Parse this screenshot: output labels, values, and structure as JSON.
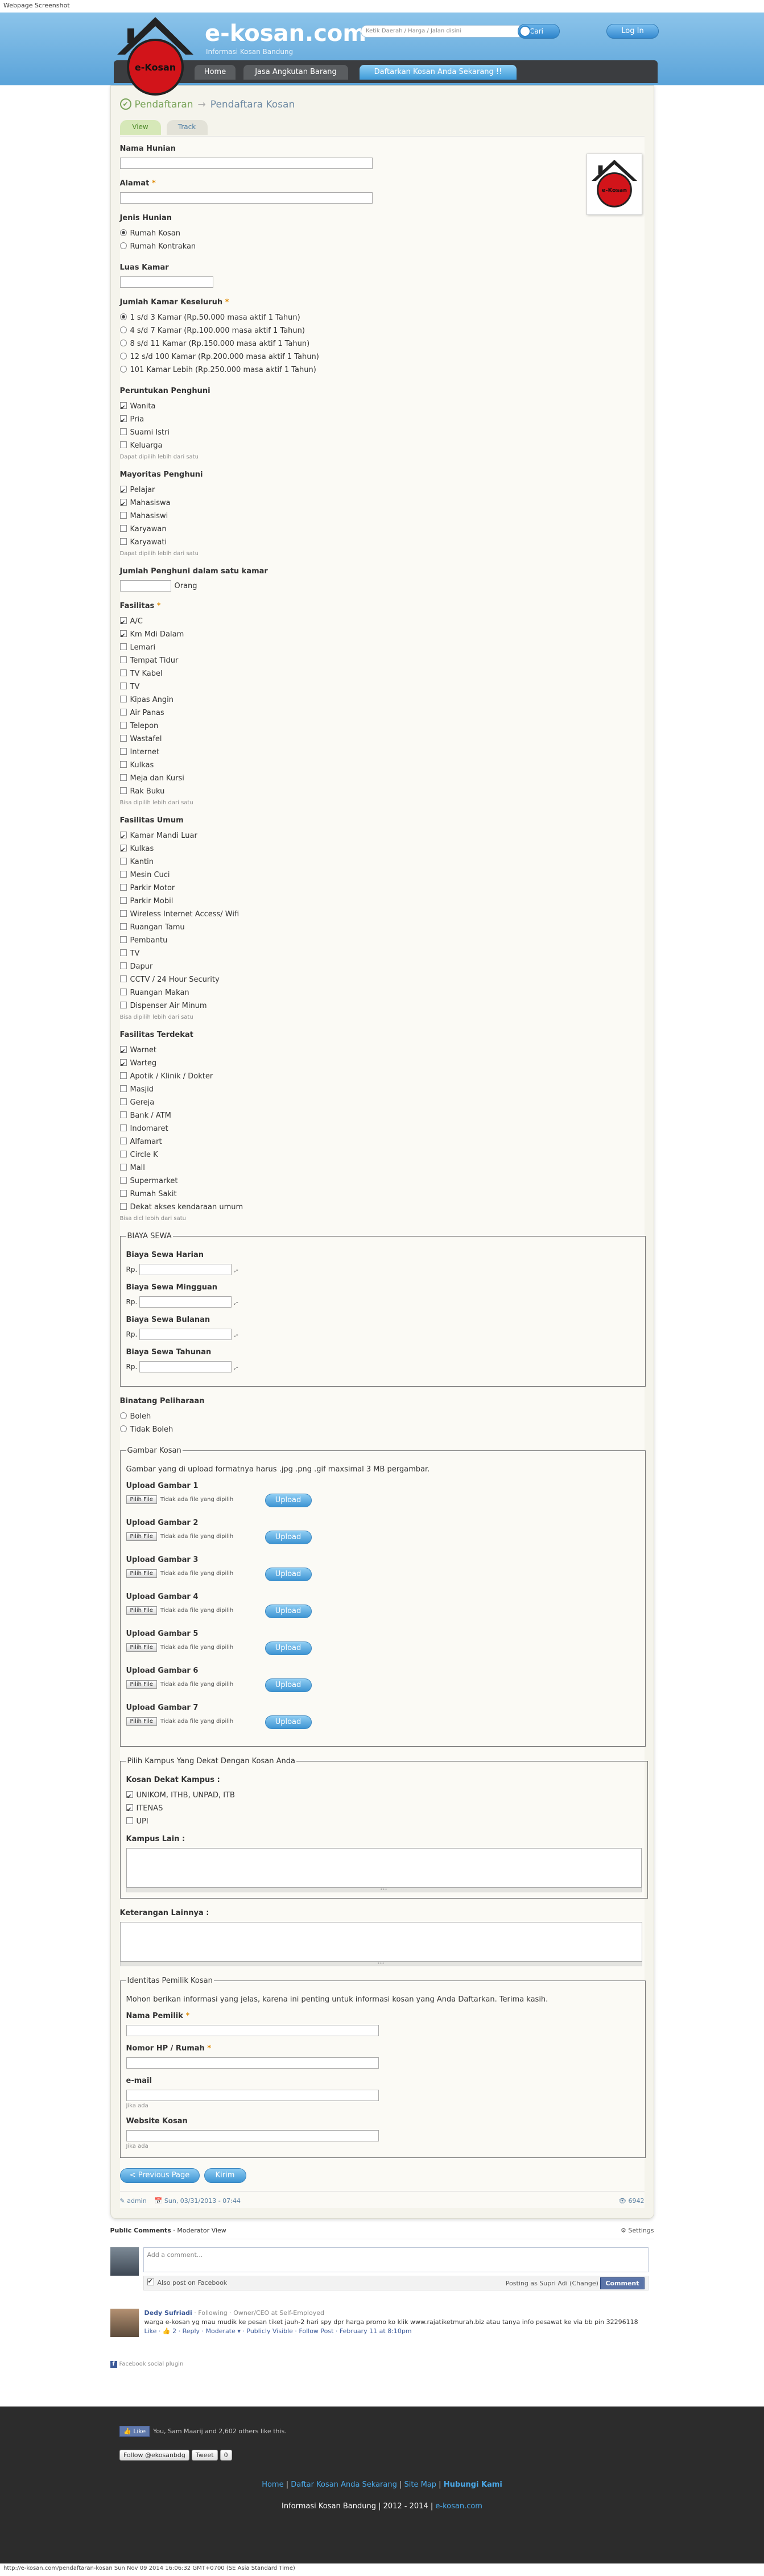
{
  "capture": {
    "title": "Webpage Screenshot",
    "footer": "http://e-kosan.com/pendaftaran-kosan Sun Nov 09 2014 16:06:32 GMT+0700 (SE Asia Standard Time)"
  },
  "header": {
    "site_name": "e-kosan.com",
    "tagline": "Informasi Kosan Bandung",
    "logo_text": "e-Kosan",
    "search_placeholder": "Ketik Daerah / Harga / Jalan disini",
    "search_button": "Cari",
    "login_button": "Log In",
    "nav": [
      "Home",
      "Jasa Angkutan Barang",
      "Daftarkan Kosan Anda Sekarang !!"
    ]
  },
  "breadcrumb": {
    "icon": "✔",
    "link": "Pendaftaran",
    "arrow": "→",
    "current": "Pendaftara Kosan"
  },
  "tabs": [
    "View",
    "Track"
  ],
  "form": {
    "nama_hunian": "Nama Hunian",
    "alamat": "Alamat",
    "jenis_hunian": {
      "label": "Jenis Hunian",
      "options": [
        "Rumah Kosan",
        "Rumah Kontrakan"
      ]
    },
    "luas_kamar": "Luas Kamar",
    "jumlah_kamar": {
      "label": "Jumlah Kamar Keseluruh",
      "options": [
        "1 s/d 3 Kamar (Rp.50.000 masa aktif 1 Tahun)",
        "4 s/d 7 Kamar (Rp.100.000 masa aktif 1 Tahun)",
        "8 s/d 11 Kamar (Rp.150.000 masa aktif 1 Tahun)",
        "12 s/d 100 Kamar (Rp.200.000 masa aktif 1 Tahun)",
        "101 Kamar Lebih (Rp.250.000 masa aktif 1 Tahun)"
      ]
    },
    "peruntukan": {
      "label": "Peruntukan Penghuni",
      "options": [
        "Wanita",
        "Pria",
        "Suami Istri",
        "Keluarga"
      ],
      "checked": [
        true,
        true,
        false,
        false
      ],
      "desc": "Dapat dipilih lebih dari satu"
    },
    "mayoritas": {
      "label": "Mayoritas Penghuni",
      "options": [
        "Pelajar",
        "Mahasiswa",
        "Mahasiswi",
        "Karyawan",
        "Karyawati"
      ],
      "checked": [
        true,
        true,
        false,
        false,
        false
      ],
      "desc": "Dapat dipilih lebih dari satu"
    },
    "jumlah_penghuni": {
      "label": "Jumlah Penghuni dalam satu kamar",
      "unit": "Orang"
    },
    "fasilitas": {
      "label": "Fasilitas",
      "options": [
        "A/C",
        "Km Mdi Dalam",
        "Lemari",
        "Tempat Tidur",
        "TV Kabel",
        "TV",
        "Kipas Angin",
        "Air Panas",
        "Telepon",
        "Wastafel",
        "Internet",
        "Kulkas",
        "Meja dan Kursi",
        "Rak Buku"
      ],
      "checked": [
        true,
        true,
        false,
        false,
        false,
        false,
        false,
        false,
        false,
        false,
        false,
        false,
        false,
        false
      ],
      "desc": "Bisa dipilih lebih dari satu"
    },
    "fasilitas_umum": {
      "label": "Fasilitas Umum",
      "options": [
        "Kamar Mandi Luar",
        "Kulkas",
        "Kantin",
        "Mesin Cuci",
        "Parkir Motor",
        "Parkir Mobil",
        "Wireless Internet Access/ Wifi",
        "Ruangan Tamu",
        "Pembantu",
        "TV",
        "Dapur",
        "CCTV / 24 Hour Security",
        "Ruangan Makan",
        "Dispenser Air Minum"
      ],
      "checked": [
        true,
        true,
        false,
        false,
        false,
        false,
        false,
        false,
        false,
        false,
        false,
        false,
        false,
        false
      ],
      "desc": "Bisa dipilih lebih dari satu"
    },
    "fasilitas_terdekat": {
      "label": "Fasilitas Terdekat",
      "options": [
        "Warnet",
        "Warteg",
        "Apotik / Klinik / Dokter",
        "Masjid",
        "Gereja",
        "Bank / ATM",
        "Indomaret",
        "Alfamart",
        "Circle K",
        "Mall",
        "Supermarket",
        "Rumah Sakit",
        "Dekat akses kendaraan umum"
      ],
      "checked": [
        true,
        true,
        false,
        false,
        false,
        false,
        false,
        false,
        false,
        false,
        false,
        false,
        false
      ],
      "desc": "Bisa dicl lebih dari satu"
    },
    "biaya": {
      "legend": "BIAYA SEWA",
      "currency": "Rp.",
      "cents": ",-",
      "items": [
        "Biaya Sewa Harian",
        "Biaya Sewa Mingguan",
        "Biaya Sewa Bulanan",
        "Biaya Sewa Tahunan"
      ]
    },
    "binatang": {
      "label": "Binatang Peliharaan",
      "options": [
        "Boleh",
        "Tidak Boleh"
      ]
    },
    "gambar": {
      "legend": "Gambar Kosan",
      "note": "Gambar yang di upload formatnya harus .jpg .png .gif maxsimal 3 MB pergambar.",
      "file_button": "Pilih File",
      "file_label": "Tidak ada file yang dipilih",
      "upload_button": "Upload",
      "items": [
        "Upload Gambar 1",
        "Upload Gambar 2",
        "Upload Gambar 3",
        "Upload Gambar 4",
        "Upload Gambar 5",
        "Upload Gambar 6",
        "Upload Gambar 7"
      ]
    },
    "kampus": {
      "legend": "Pilih Kampus Yang Dekat Dengan Kosan Anda",
      "label": "Kosan Dekat Kampus :",
      "options": [
        "UNIKOM, ITHB, UNPAD, ITB",
        "ITENAS",
        "UPI"
      ],
      "checked": [
        true,
        true,
        false
      ],
      "lain": "Kampus Lain :"
    },
    "keterangan": "Keterangan Lainnya :",
    "pemilik": {
      "legend": "Identitas Pemilik Kosan",
      "note": "Mohon berikan informasi yang jelas, karena ini penting untuk informasi kosan yang Anda Daftarkan. Terima kasih.",
      "nama": "Nama Pemilik",
      "hp": "Nomor HP / Rumah",
      "email": "e-mail",
      "email_desc": "Jika ada",
      "website": "Website Kosan",
      "website_desc": "Jika ada"
    },
    "prev_button": "< Previous Page",
    "submit_button": "Kirim"
  },
  "meta": {
    "author": "admin",
    "date": "Sun, 03/31/2013 - 07:44",
    "count": "6942"
  },
  "comments": {
    "public": "Public Comments",
    "moderator": "Moderator View",
    "settings": "Settings",
    "placeholder": "Add a comment...",
    "also_post": "Also post on Facebook",
    "posting_as": "Posting as Supri Adi (Change)",
    "post_button": "Comment",
    "entry": {
      "name": "Dedy Sufriadi",
      "sub": "· Following · Owner/CEO at Self-Employed",
      "text": "warga e-kosan yg mau mudik ke pesan tiket jauh-2 hari spy dpr harga promo ko klik www.rajatiketmurah.biz atau tanya info pesawat ke via bb pin 32296118",
      "actions": "Like · 👍 2 · Reply · Moderate ▾ · Publicly Visible · Follow Post · February 11 at 8:10pm"
    },
    "plugin": "Facebook social plugin"
  },
  "footer": {
    "like_button": "Like",
    "like_text": "You, Sam Maarij and 2,602 others like this.",
    "follow_button": "Follow @ekosanbdg",
    "tweet_button": "Tweet",
    "tweet_count": "0",
    "links": [
      "Home",
      "Daftar Kosan Anda Sekarang",
      "Site Map",
      "Hubungi Kami"
    ],
    "copyright": "Informasi Kosan Bandung | 2012 - 2014 |",
    "copyright_site": "e-kosan.com"
  }
}
